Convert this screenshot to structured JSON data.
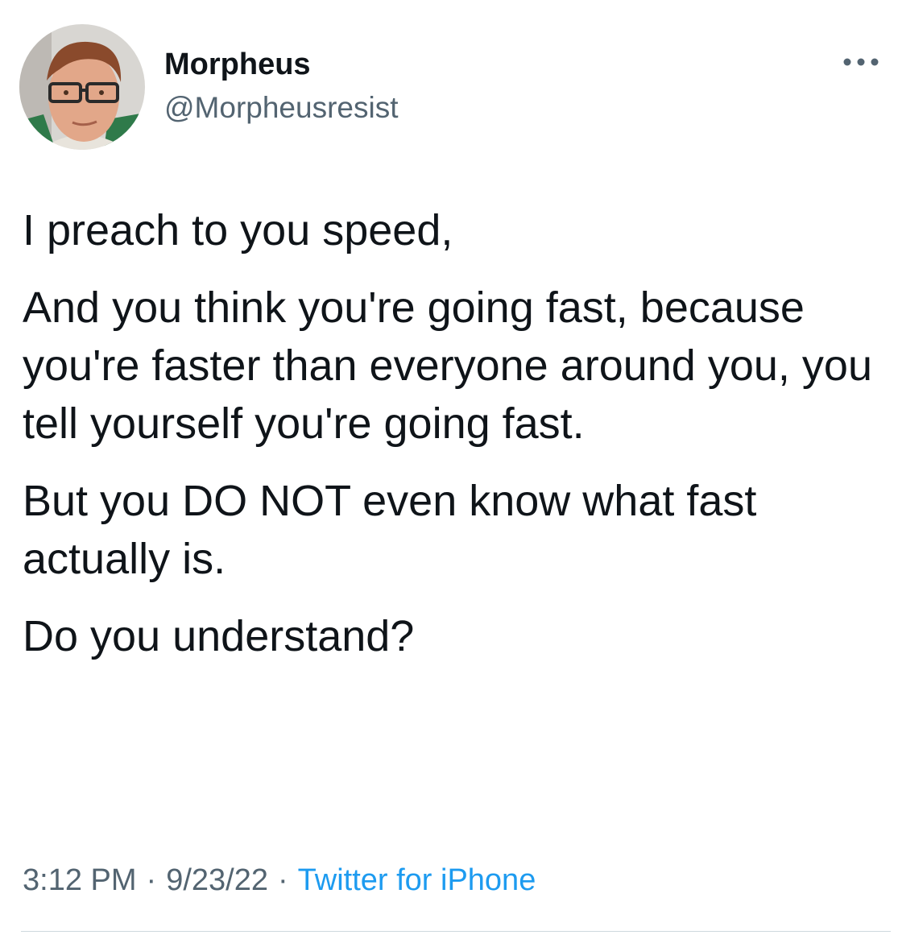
{
  "author": {
    "display_name": "Morpheus",
    "handle": "@Morpheusresist",
    "avatar_icon": "profile-photo"
  },
  "more_icon": "more-horizontal-icon",
  "tweet": {
    "paragraphs": [
      "I preach to you speed,",
      "And you think you're going fast, because you're faster than everyone around you, you tell yourself you're going fast.",
      "But you DO NOT even know what fast actually is.",
      "Do you understand?"
    ],
    "time": "3:12 PM",
    "date": "9/23/22",
    "source": "Twitter for iPhone",
    "separator": "·"
  },
  "colors": {
    "text_primary": "#0f1419",
    "text_secondary": "#536471",
    "link_blue": "#1d9bf0",
    "divider": "#cfd9de"
  }
}
